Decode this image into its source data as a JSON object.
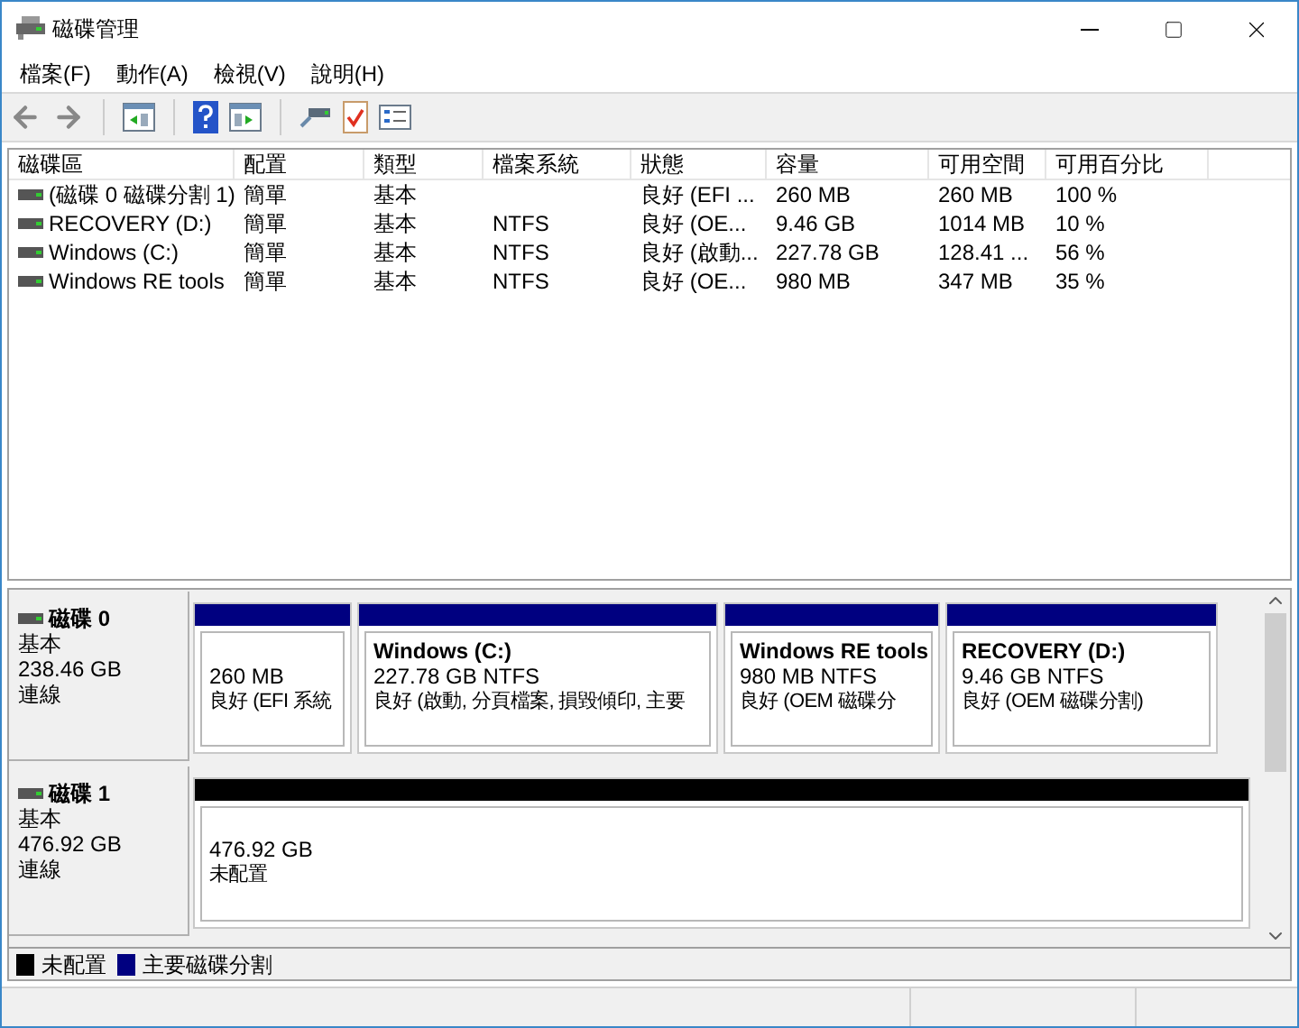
{
  "window": {
    "title": "磁碟管理"
  },
  "menu": [
    "檔案(F)",
    "動作(A)",
    "檢視(V)",
    "說明(H)"
  ],
  "volume_table": {
    "columns": [
      "磁碟區",
      "配置",
      "類型",
      "檔案系統",
      "狀態",
      "容量",
      "可用空間",
      "可用百分比"
    ],
    "rows": [
      {
        "cells": [
          "(磁碟 0 磁碟分割 1)",
          "簡單",
          "基本",
          "",
          "良好 (EFI ...",
          "260 MB",
          "260 MB",
          "100 %"
        ]
      },
      {
        "cells": [
          "RECOVERY (D:)",
          "簡單",
          "基本",
          "NTFS",
          "良好 (OE...",
          "9.46 GB",
          "1014 MB",
          "10 %"
        ]
      },
      {
        "cells": [
          "Windows (C:)",
          "簡單",
          "基本",
          "NTFS",
          "良好 (啟動...",
          "227.78 GB",
          "128.41 ...",
          "56 %"
        ]
      },
      {
        "cells": [
          "Windows RE tools",
          "簡單",
          "基本",
          "NTFS",
          "良好 (OE...",
          "980 MB",
          "347 MB",
          "35 %"
        ]
      }
    ]
  },
  "disks": [
    {
      "name": "磁碟 0",
      "type": "基本",
      "size": "238.46 GB",
      "status": "連線",
      "partitions": [
        {
          "kind": "primary",
          "color": "#000080",
          "size": "260 MB",
          "status": "良好 (EFI 系統"
        },
        {
          "kind": "primary",
          "color": "#000080",
          "name": "Windows  (C:)",
          "size": "227.78 GB NTFS",
          "status": "良好 (啟動, 分頁檔案, 損毀傾印, 主要"
        },
        {
          "kind": "primary",
          "color": "#000080",
          "name": "Windows RE tools",
          "size": "980 MB NTFS",
          "status": "良好 (OEM 磁碟分"
        },
        {
          "kind": "primary",
          "color": "#000080",
          "name": "RECOVERY  (D:)",
          "size": "9.46 GB NTFS",
          "status": "良好 (OEM 磁碟分割)"
        }
      ]
    },
    {
      "name": "磁碟 1",
      "type": "基本",
      "size": "476.92 GB",
      "status": "連線",
      "partitions": [
        {
          "kind": "unallocated",
          "color": "#000000",
          "size": "476.92 GB",
          "status": "未配置"
        }
      ]
    }
  ],
  "legend": [
    {
      "label": "未配置",
      "color": "#000000"
    },
    {
      "label": "主要磁碟分割",
      "color": "#000080"
    }
  ]
}
